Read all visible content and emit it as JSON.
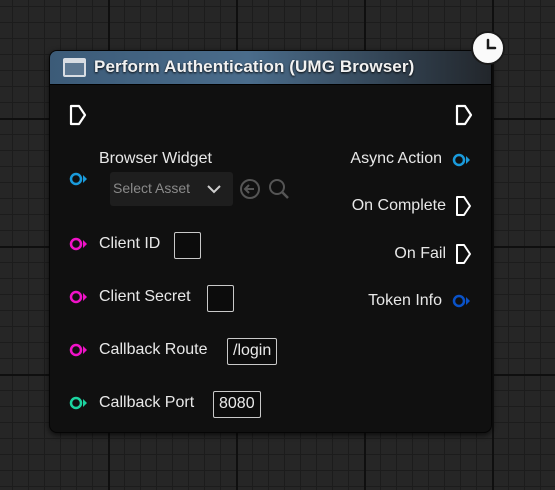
{
  "node": {
    "title": "Perform Authentication (UMG Browser)",
    "icons": {
      "title": "widget-blueprint-icon",
      "latent": "clock-icon"
    },
    "colors": {
      "header": "#4a6c8b",
      "object_pin": "#1a9bdc",
      "string_pin": "#f012c8",
      "int_pin": "#1cd4a0",
      "struct_pin": "#0a52c8",
      "exec_pin": "#ffffff"
    },
    "inputs": {
      "browser_widget": {
        "label": "Browser Widget",
        "placeholder": "Select Asset"
      },
      "client_id": {
        "label": "Client ID",
        "value": ""
      },
      "client_secret": {
        "label": "Client Secret",
        "value": ""
      },
      "callback_route": {
        "label": "Callback Route",
        "value": "/login"
      },
      "callback_port": {
        "label": "Callback Port",
        "value": "8080"
      }
    },
    "outputs": {
      "async_action": "Async Action",
      "on_complete": "On Complete",
      "on_fail": "On Fail",
      "token_info": "Token Info"
    }
  }
}
